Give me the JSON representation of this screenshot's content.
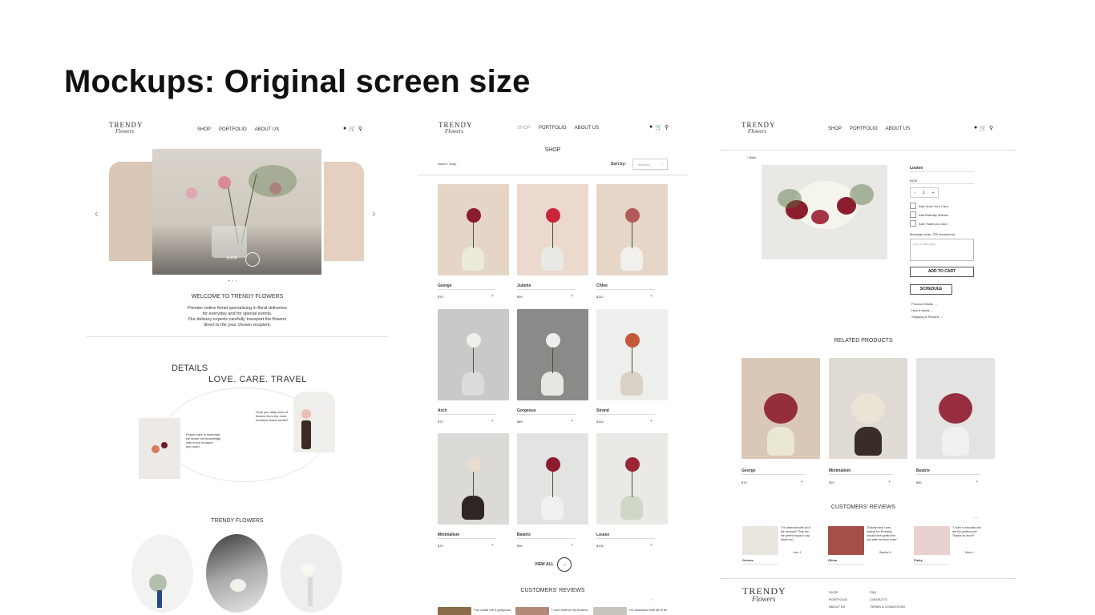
{
  "title": "Mockups: Original screen size",
  "brand": {
    "line1": "TRENDY",
    "line2": "Flowers"
  },
  "nav": {
    "shop": "SHOP",
    "portfolio": "PORTFOLIO",
    "about": "ABOUT US"
  },
  "icons": [
    "user-icon",
    "cart-icon",
    "search-icon"
  ],
  "home": {
    "hero_button": "SHOP",
    "welcome_title": "WELCOME TO TRENDY FLOWERS",
    "welcome_lines": [
      "Premier online florist specializing in floral deliveries",
      "for everyday and for special events.",
      "Our delivery experts carefully transport the flowers",
      "direct to the your chosen recipient."
    ],
    "details_title": "DETAILS",
    "details_tagline": "LOVE. CARE. TRAVEL",
    "details_note_right": [
      "Grab you daily dose of",
      "flowers from the most",
      "trendiest flower studio!"
    ],
    "details_note_left": [
      "Flower care is essential,",
      "we share our knowledge",
      "with every bouquet",
      "you order."
    ],
    "section_title": "TRENDY FLOWERS"
  },
  "shop": {
    "title": "SHOP",
    "breadcrumb": "Home / Shop",
    "sort_label": "Sort by:",
    "sort_value": "featured",
    "products": [
      {
        "name": "George",
        "price": "$70"
      },
      {
        "name": "Juliette",
        "price": "$90"
      },
      {
        "name": "Chloe",
        "price": "$110"
      },
      {
        "name": "Arch",
        "price": "$70"
      },
      {
        "name": "Gorgeous",
        "price": "$69"
      },
      {
        "name": "Strand",
        "price": "$115"
      },
      {
        "name": "Minimalism",
        "price": "$70"
      },
      {
        "name": "Beatrix",
        "price": "$90"
      },
      {
        "name": "Louise",
        "price": "$130"
      }
    ],
    "view_all": "VIEW ALL",
    "reviews_title": "CUSTOMERS' REVIEWS",
    "review_snippets": [
      "\"You made me a gorgeous. I'm so thankful\"",
      "\"I can't believe my flowers. Absolutely stunning\"",
      "\"I'm obsessed with all of the products\""
    ]
  },
  "product": {
    "back": "Back",
    "name": "Louise",
    "price": "$130",
    "qty": "1",
    "options": [
      "Add Grow Your Card",
      "Add Birthday Wishes",
      "Add Thank you card"
    ],
    "message_label": "Message (max. 200 characters)",
    "message_placeholder": "Add a message",
    "add_to_cart": "ADD TO CART",
    "schedule": "SCHEDULE",
    "links": [
      "Product Details",
      "How it works",
      "Shipping & Returns"
    ],
    "related_title": "RELATED PRODUCTS",
    "related": [
      {
        "name": "George",
        "price": "$70"
      },
      {
        "name": "Minimalism",
        "price": "$70"
      },
      {
        "name": "Beatrix",
        "price": "$90"
      }
    ],
    "reviews_title": "CUSTOMERS' REVIEWS",
    "reviews": [
      {
        "text": "\"I'm obsessed with all of the products! They are the perfect ways to say thank you\"",
        "author": "Ann J.",
        "product": "Greens"
      },
      {
        "text": "\"Exactly what I was looking for. Probably should have gotten this one after my shop order\"",
        "author": "Sandra K.",
        "product": "Olivia"
      },
      {
        "text": "\"I order in beautiful and are the perfect size! Thanks so much!\"",
        "author": "Kiery L.",
        "product": "Pinky"
      }
    ],
    "footer_col1": [
      "SHOP",
      "PORTFOLIO",
      "ABOUT US"
    ],
    "footer_col2": [
      "FAQ",
      "CONTACTS",
      "TERMS & CONDITIONS"
    ]
  },
  "colors": {
    "beige": "#e8d9cd",
    "grey": "#e4e4e2",
    "dark": "#3a3432",
    "red": "#8c1d2e",
    "green": "#4a6a36"
  }
}
